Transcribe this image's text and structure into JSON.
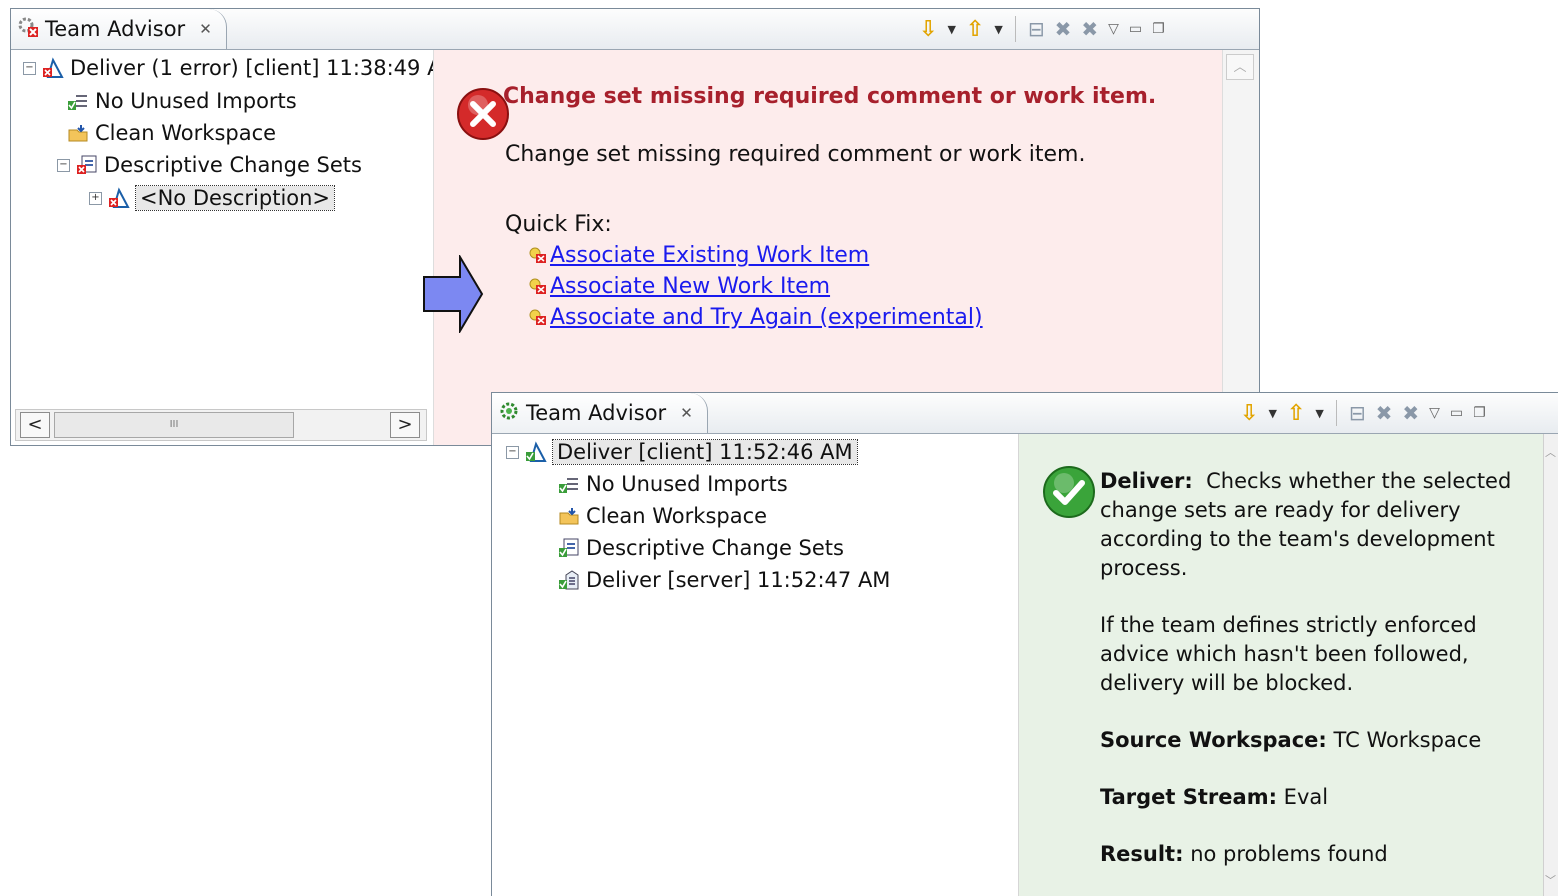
{
  "top_panel": {
    "tab_title": "Team Advisor",
    "tree": {
      "root": "Deliver (1 error) [client] 11:38:49 A",
      "children": [
        "No Unused Imports",
        "Clean Workspace",
        "Descriptive Change Sets"
      ],
      "grandchild": "<No Description>"
    },
    "scroll_mid": "III",
    "detail": {
      "title": "Change set missing required comment or work item.",
      "body": "Change set missing required comment or work item.",
      "quick_fix_label": "Quick Fix:",
      "quick_fixes": [
        "Associate Existing Work Item",
        "Associate New Work Item",
        "Associate and Try Again (experimental)"
      ]
    }
  },
  "bottom_panel": {
    "tab_title": "Team Advisor",
    "tree": {
      "root": "Deliver [client] 11:52:46 AM",
      "children": [
        "No Unused Imports",
        "Clean Workspace",
        "Descriptive Change Sets",
        "Deliver [server] 11:52:47 AM"
      ]
    },
    "detail": {
      "deliver_label": "Deliver:",
      "deliver_text": "Checks whether the selected change sets are ready for delivery according to the team's development process.",
      "enforced_text": "If the team defines strictly enforced advice which hasn't been followed, delivery will be blocked.",
      "source_label": "Source Workspace:",
      "source_value": "TC Workspace",
      "target_label": "Target Stream:",
      "target_value": "Eval",
      "result_label": "Result:",
      "result_value": "no problems found"
    }
  },
  "colors": {
    "error_bg": "#fdecec",
    "ok_bg": "#e8f2e6",
    "error_title": "#a7202c",
    "link": "#1a1aee",
    "arrow_fill": "#7c88f2"
  },
  "icons": [
    "team-advisor-icon",
    "error-icon",
    "ok-icon",
    "quick-fix-icon",
    "next-icon",
    "previous-icon"
  ]
}
